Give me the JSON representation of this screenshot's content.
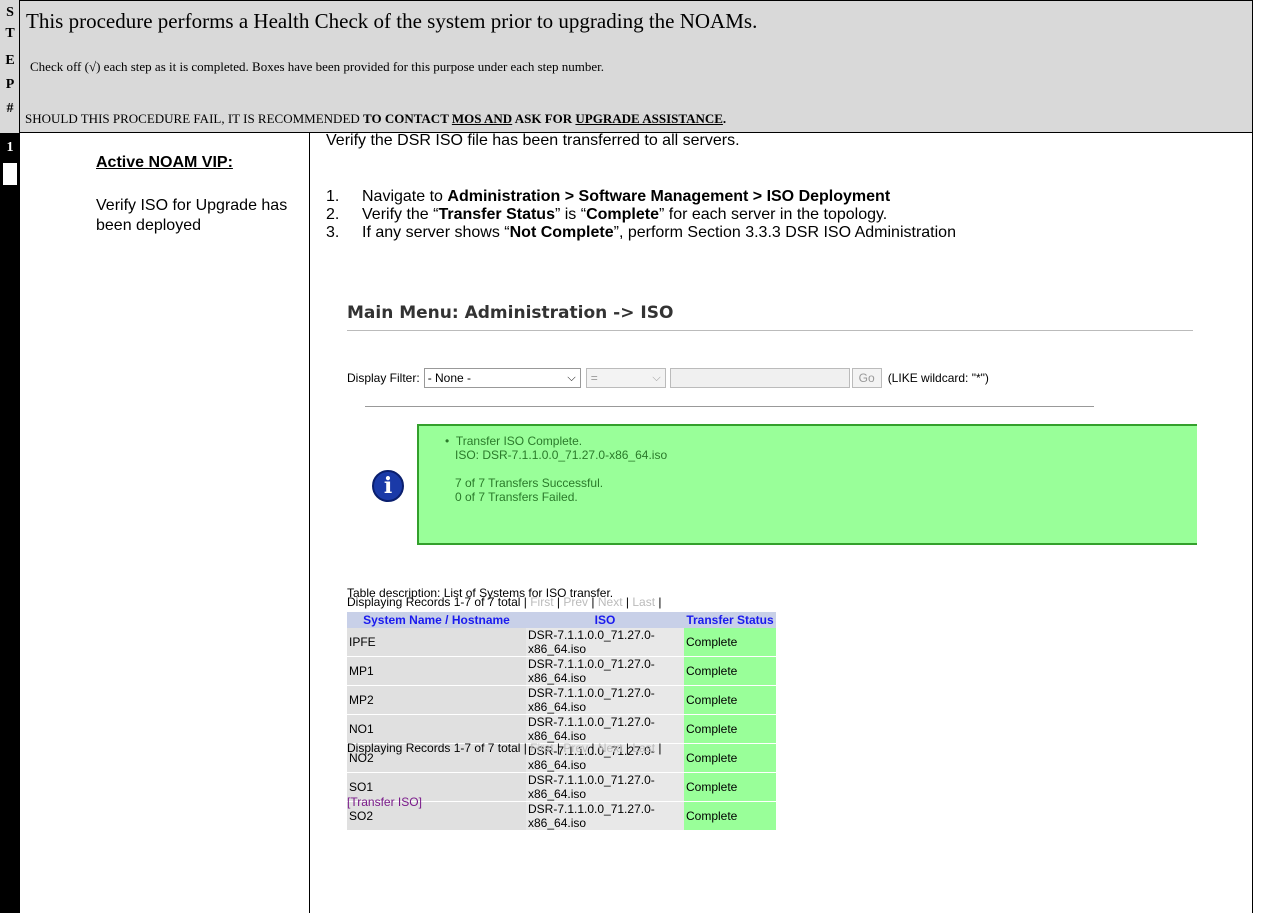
{
  "step_column": {
    "letters": [
      "S",
      "T",
      "E",
      "P",
      "#"
    ],
    "step_number": "1"
  },
  "header": {
    "title": "This procedure performs a Health Check of the system prior to upgrading the NOAMs.",
    "subtitle": "Check off (√) each step as it is completed. Boxes have been provided for this purpose under each step number.",
    "fail_prefix": "SHOULD THIS PROCEDURE FAIL, IT IS RECOMMENDED ",
    "fail_bold1": "TO CONTACT ",
    "fail_u1": "MOS AND",
    "fail_bold2": " ASK FOR ",
    "fail_u2": "UPGRADE ASSISTANCE",
    "fail_end": "."
  },
  "step": {
    "left_title": "Active NOAM VIP:",
    "left_desc": "Verify ISO for Upgrade has been deployed",
    "intro": "Verify the DSR ISO file has been transferred to all servers.",
    "items": [
      {
        "num": "1.",
        "pre": "Navigate to ",
        "bold": "Administration > Software Management > ISO Deployment",
        "post": "",
        "bold2": "",
        "post2": ""
      },
      {
        "num": "2.",
        "pre": "Verify the “",
        "bold": "Transfer Status",
        "post": "” is “",
        "bold2": "Complete",
        "post2": "” for each server in the topology."
      },
      {
        "num": "3.",
        "pre": "If any server shows “",
        "bold": "Not Complete",
        "post": "”, perform Section 3.3.3 DSR ISO Administration",
        "bold2": "",
        "post2": ""
      }
    ]
  },
  "screenshot": {
    "main_menu": "Main Menu: Administration -> ISO",
    "filter_label": "Display Filter:",
    "filter_value": "- None -",
    "op_value": "=",
    "go_label": "Go",
    "wildcard": "(LIKE wildcard: \"*\")",
    "info_lines": [
      "Transfer ISO Complete.",
      "ISO:  DSR-7.1.1.0.0_71.27.0-x86_64.iso",
      "7 of 7 Transfers Successful.",
      "0 of 7 Transfers Failed."
    ],
    "table_description": "Table description: List of Systems for ISO transfer.",
    "displaying": "Displaying Records 1-7 of 7 total |",
    "nav": {
      "first": "First",
      "prev": "Prev",
      "next": "Next",
      "last": "Last",
      "sep": "|"
    },
    "columns": [
      "System Name / Hostname",
      "ISO",
      "Transfer Status"
    ],
    "rows": [
      [
        "IPFE",
        "DSR-7.1.1.0.0_71.27.0-x86_64.iso",
        "Complete"
      ],
      [
        "MP1",
        "DSR-7.1.1.0.0_71.27.0-x86_64.iso",
        "Complete"
      ],
      [
        "MP2",
        "DSR-7.1.1.0.0_71.27.0-x86_64.iso",
        "Complete"
      ],
      [
        "NO1",
        "DSR-7.1.1.0.0_71.27.0-x86_64.iso",
        "Complete"
      ],
      [
        "NO2",
        "DSR-7.1.1.0.0_71.27.0-x86_64.iso",
        "Complete"
      ],
      [
        "SO1",
        "DSR-7.1.1.0.0_71.27.0-x86_64.iso",
        "Complete"
      ],
      [
        "SO2",
        "DSR-7.1.1.0.0_71.27.0-x86_64.iso",
        "Complete"
      ]
    ],
    "transfer_link": "[Transfer ISO]"
  }
}
